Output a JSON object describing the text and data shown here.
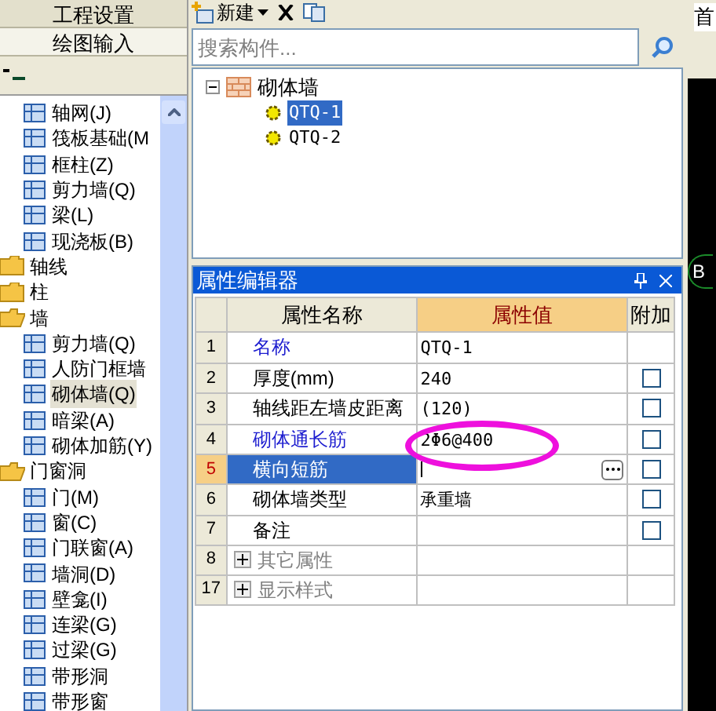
{
  "nav_buttons": [
    {
      "label": "工程设置",
      "selected": false
    },
    {
      "label": "绘图输入",
      "selected": true
    }
  ],
  "module_tree": [
    {
      "label": "轴网(J)",
      "kind": "item",
      "selected": false
    },
    {
      "label": "筏板基础(M",
      "kind": "item",
      "selected": false
    },
    {
      "label": "框柱(Z)",
      "kind": "item",
      "selected": false
    },
    {
      "label": "剪力墙(Q)",
      "kind": "item",
      "selected": false
    },
    {
      "label": "梁(L)",
      "kind": "item",
      "selected": false
    },
    {
      "label": "现浇板(B)",
      "kind": "item",
      "selected": false
    },
    {
      "label": "轴线",
      "kind": "folder",
      "expanded": false
    },
    {
      "label": "柱",
      "kind": "folder",
      "expanded": false
    },
    {
      "label": "墙",
      "kind": "folder",
      "expanded": true,
      "children": [
        {
          "label": "剪力墙(Q)",
          "kind": "item",
          "selected": false
        },
        {
          "label": "人防门框墙",
          "kind": "item",
          "selected": false
        },
        {
          "label": "砌体墙(Q)",
          "kind": "item",
          "selected": true
        },
        {
          "label": "暗梁(A)",
          "kind": "item",
          "selected": false
        },
        {
          "label": "砌体加筋(Y)",
          "kind": "item",
          "selected": false
        }
      ]
    },
    {
      "label": "门窗洞",
      "kind": "folder",
      "expanded": true,
      "children": [
        {
          "label": "门(M)",
          "kind": "item",
          "selected": false
        },
        {
          "label": "窗(C)",
          "kind": "item",
          "selected": false
        },
        {
          "label": "门联窗(A)",
          "kind": "item",
          "selected": false
        },
        {
          "label": "墙洞(D)",
          "kind": "item",
          "selected": false
        },
        {
          "label": "壁龛(I)",
          "kind": "item",
          "selected": false
        },
        {
          "label": "连梁(G)",
          "kind": "item",
          "selected": false
        },
        {
          "label": "过梁(G)",
          "kind": "item",
          "selected": false
        },
        {
          "label": "带形洞",
          "kind": "item",
          "selected": false
        },
        {
          "label": "带形窗",
          "kind": "item",
          "selected": false
        }
      ]
    }
  ],
  "toolbar": {
    "new_label": "新建"
  },
  "search": {
    "placeholder": "搜索构件..."
  },
  "component_tree": [
    {
      "label": "砌体墙",
      "expanded": true,
      "children": [
        {
          "label": "QTQ-1",
          "selected": true
        },
        {
          "label": "QTQ-2",
          "selected": false
        }
      ]
    }
  ],
  "property_editor": {
    "title": "属性编辑器",
    "columns": [
      "属性名称",
      "属性值",
      "附加"
    ],
    "rows": [
      {
        "kind": "property",
        "number": "1",
        "name": "名称",
        "value": "QTQ-1",
        "emphasized": true,
        "selected": false
      },
      {
        "kind": "property",
        "number": "2",
        "name": "厚度(mm)",
        "value": "240",
        "emphasized": false,
        "selected": false,
        "checked": false
      },
      {
        "kind": "property",
        "number": "3",
        "name": "轴线距左墙皮距离",
        "value": "(120)",
        "emphasized": false,
        "selected": false,
        "checked": false
      },
      {
        "kind": "property",
        "number": "4",
        "name": "砌体通长筋",
        "value": "2Φ6@400",
        "emphasized": true,
        "selected": false,
        "checked": false,
        "circled": true
      },
      {
        "kind": "property",
        "number": "5",
        "name": "横向短筋",
        "emphasized": false,
        "selected": true,
        "checked": false
      },
      {
        "kind": "property",
        "number": "6",
        "name": "砌体墙类型",
        "value": "承重墙",
        "emphasized": false,
        "selected": false,
        "checked": false
      },
      {
        "kind": "property",
        "number": "7",
        "name": "备注",
        "emphasized": false,
        "selected": false,
        "checked": false
      },
      {
        "kind": "group",
        "number": "8",
        "name": "其它属性",
        "expanded": false
      },
      {
        "kind": "group",
        "number": "17",
        "name": "显示样式",
        "expanded": false
      }
    ]
  },
  "right_panel": {
    "tab_label": "首",
    "axis_label": "B"
  }
}
